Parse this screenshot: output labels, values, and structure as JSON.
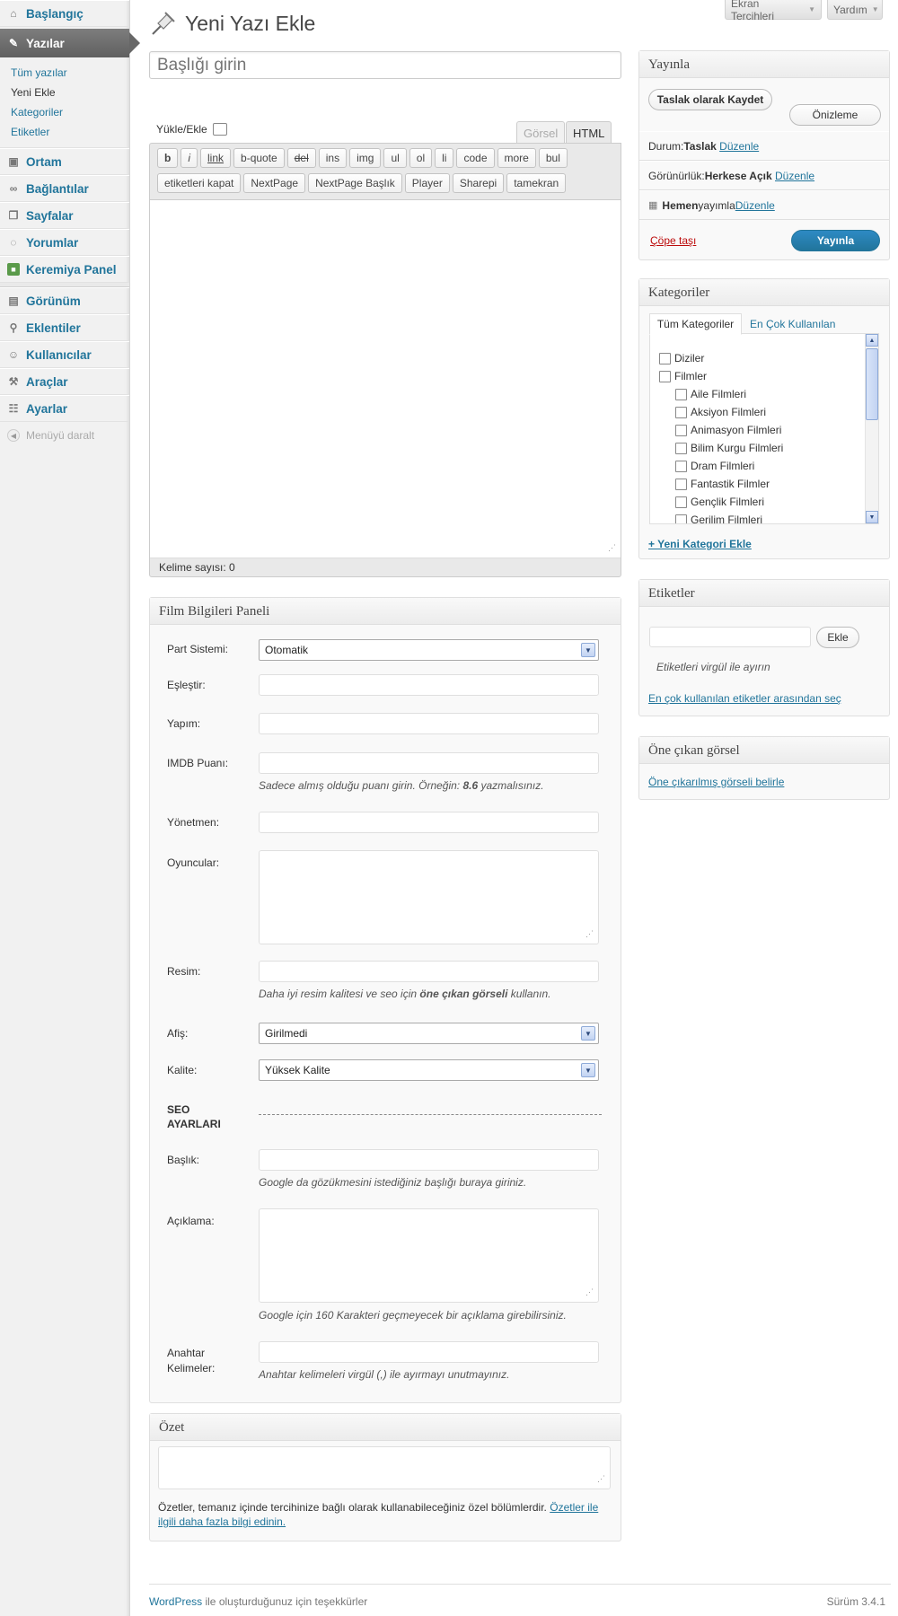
{
  "sidebar": {
    "items": [
      {
        "label": "Başlangıç",
        "icon": "dashboard-icon"
      },
      {
        "label": "Yazılar",
        "icon": "pin-icon"
      },
      {
        "label": "Ortam",
        "icon": "media-icon"
      },
      {
        "label": "Bağlantılar",
        "icon": "link-icon"
      },
      {
        "label": "Sayfalar",
        "icon": "pages-icon"
      },
      {
        "label": "Yorumlar",
        "icon": "comments-icon"
      },
      {
        "label": "Keremiya Panel",
        "icon": "panel-icon"
      },
      {
        "label": "Görünüm",
        "icon": "appearance-icon"
      },
      {
        "label": "Eklentiler",
        "icon": "plugins-icon"
      },
      {
        "label": "Kullanıcılar",
        "icon": "users-icon"
      },
      {
        "label": "Araçlar",
        "icon": "tools-icon"
      },
      {
        "label": "Ayarlar",
        "icon": "settings-icon"
      }
    ],
    "submenu": [
      "Tüm yazılar",
      "Yeni Ekle",
      "Kategoriler",
      "Etiketler"
    ],
    "collapse_label": "Menüyü daralt"
  },
  "top": {
    "screen_options": "Ekran Tercihleri",
    "help": "Yardım"
  },
  "page_title": "Yeni Yazı Ekle",
  "title_placeholder": "Başlığı girin",
  "editor": {
    "upload_label": "Yükle/Ekle",
    "tab_visual": "Görsel",
    "tab_html": "HTML",
    "buttons": [
      "b",
      "i",
      "link",
      "b-quote",
      "del",
      "ins",
      "img",
      "ul",
      "ol",
      "li",
      "code",
      "more",
      "bul",
      "etiketleri kapat",
      "NextPage",
      "NextPage Başlık",
      "Player",
      "Sharepi",
      "tamekran"
    ],
    "word_count": "Kelime sayısı: 0"
  },
  "film_panel": {
    "title": "Film Bilgileri Paneli",
    "part_label": "Part Sistemi:",
    "part_value": "Otomatik",
    "eslestir_label": "Eşleştir:",
    "yapim_label": "Yapım:",
    "imdb_label": "IMDB Puanı:",
    "imdb_hint_pre": "Sadece almış olduğu puanı girin. Örneğin: ",
    "imdb_hint_bold": "8.6",
    "imdb_hint_post": " yazmalısınız.",
    "yonetmen_label": "Yönetmen:",
    "oyuncular_label": "Oyuncular:",
    "resim_label": "Resim:",
    "resim_hint_pre": "Daha iyi resim kalitesi ve seo için ",
    "resim_hint_bold": "öne çıkan görseli",
    "resim_hint_post": " kullanın.",
    "afis_label": "Afiş:",
    "afis_value": "Girilmedi",
    "kalite_label": "Kalite:",
    "kalite_value": "Yüksek Kalite",
    "seo_label": "SEO AYARLARI",
    "baslik_label": "Başlık:",
    "baslik_hint": "Google da gözükmesini istediğiniz başlığı buraya giriniz.",
    "aciklama_label": "Açıklama:",
    "aciklama_hint": "Google için 160 Karakteri geçmeyecek bir açıklama girebilirsiniz.",
    "anahtar_label": "Anahtar Kelimeler:",
    "anahtar_hint": "Anahtar kelimeleri virgül (,) ile ayırmayı unutmayınız."
  },
  "excerpt": {
    "title": "Özet",
    "text": "Özetler, temanız içinde tercihinize bağlı olarak kullanabileceğiniz özel bölümlerdir. ",
    "link": "Özetler ile ilgili daha fazla bilgi edinin."
  },
  "publish": {
    "title": "Yayınla",
    "save_draft": "Taslak olarak Kaydet",
    "preview": "Önizleme",
    "status_label": "Durum: ",
    "status_value": "Taslak",
    "edit": "Düzenle",
    "visibility_label": "Görünürlük: ",
    "visibility_value": "Herkese Açık",
    "schedule_bold": "Hemen",
    "schedule_text": " yayımla ",
    "trash": "Çöpe taşı",
    "publish_btn": "Yayınla"
  },
  "categories": {
    "title": "Kategoriler",
    "tab_all": "Tüm Kategoriler",
    "tab_popular": "En Çok Kullanılan",
    "items": [
      "Diziler",
      "Filmler",
      "Aile Filmleri",
      "Aksiyon Filmleri",
      "Animasyon Filmleri",
      "Bilim Kurgu Filmleri",
      "Dram Filmleri",
      "Fantastik Filmler",
      "Gençlik Filmleri",
      "Gerilim Filmleri"
    ],
    "add_new": "+ Yeni Kategori Ekle"
  },
  "tags": {
    "title": "Etiketler",
    "add_btn": "Ekle",
    "hint": "Etiketleri virgül ile ayırın",
    "popular_link": "En çok kullanılan etiketler arasından seç"
  },
  "featured": {
    "title": "Öne çıkan görsel",
    "link": "Öne çıkarılmış görseli belirle"
  },
  "footer": {
    "wp_link": "WordPress",
    "thanks": " ile oluşturduğunuz için teşekkürler",
    "version": "Sürüm 3.4.1"
  },
  "colors": {
    "link": "#21759b",
    "publish_button": "#2a7bb0",
    "trash": "#bc0b0b"
  }
}
